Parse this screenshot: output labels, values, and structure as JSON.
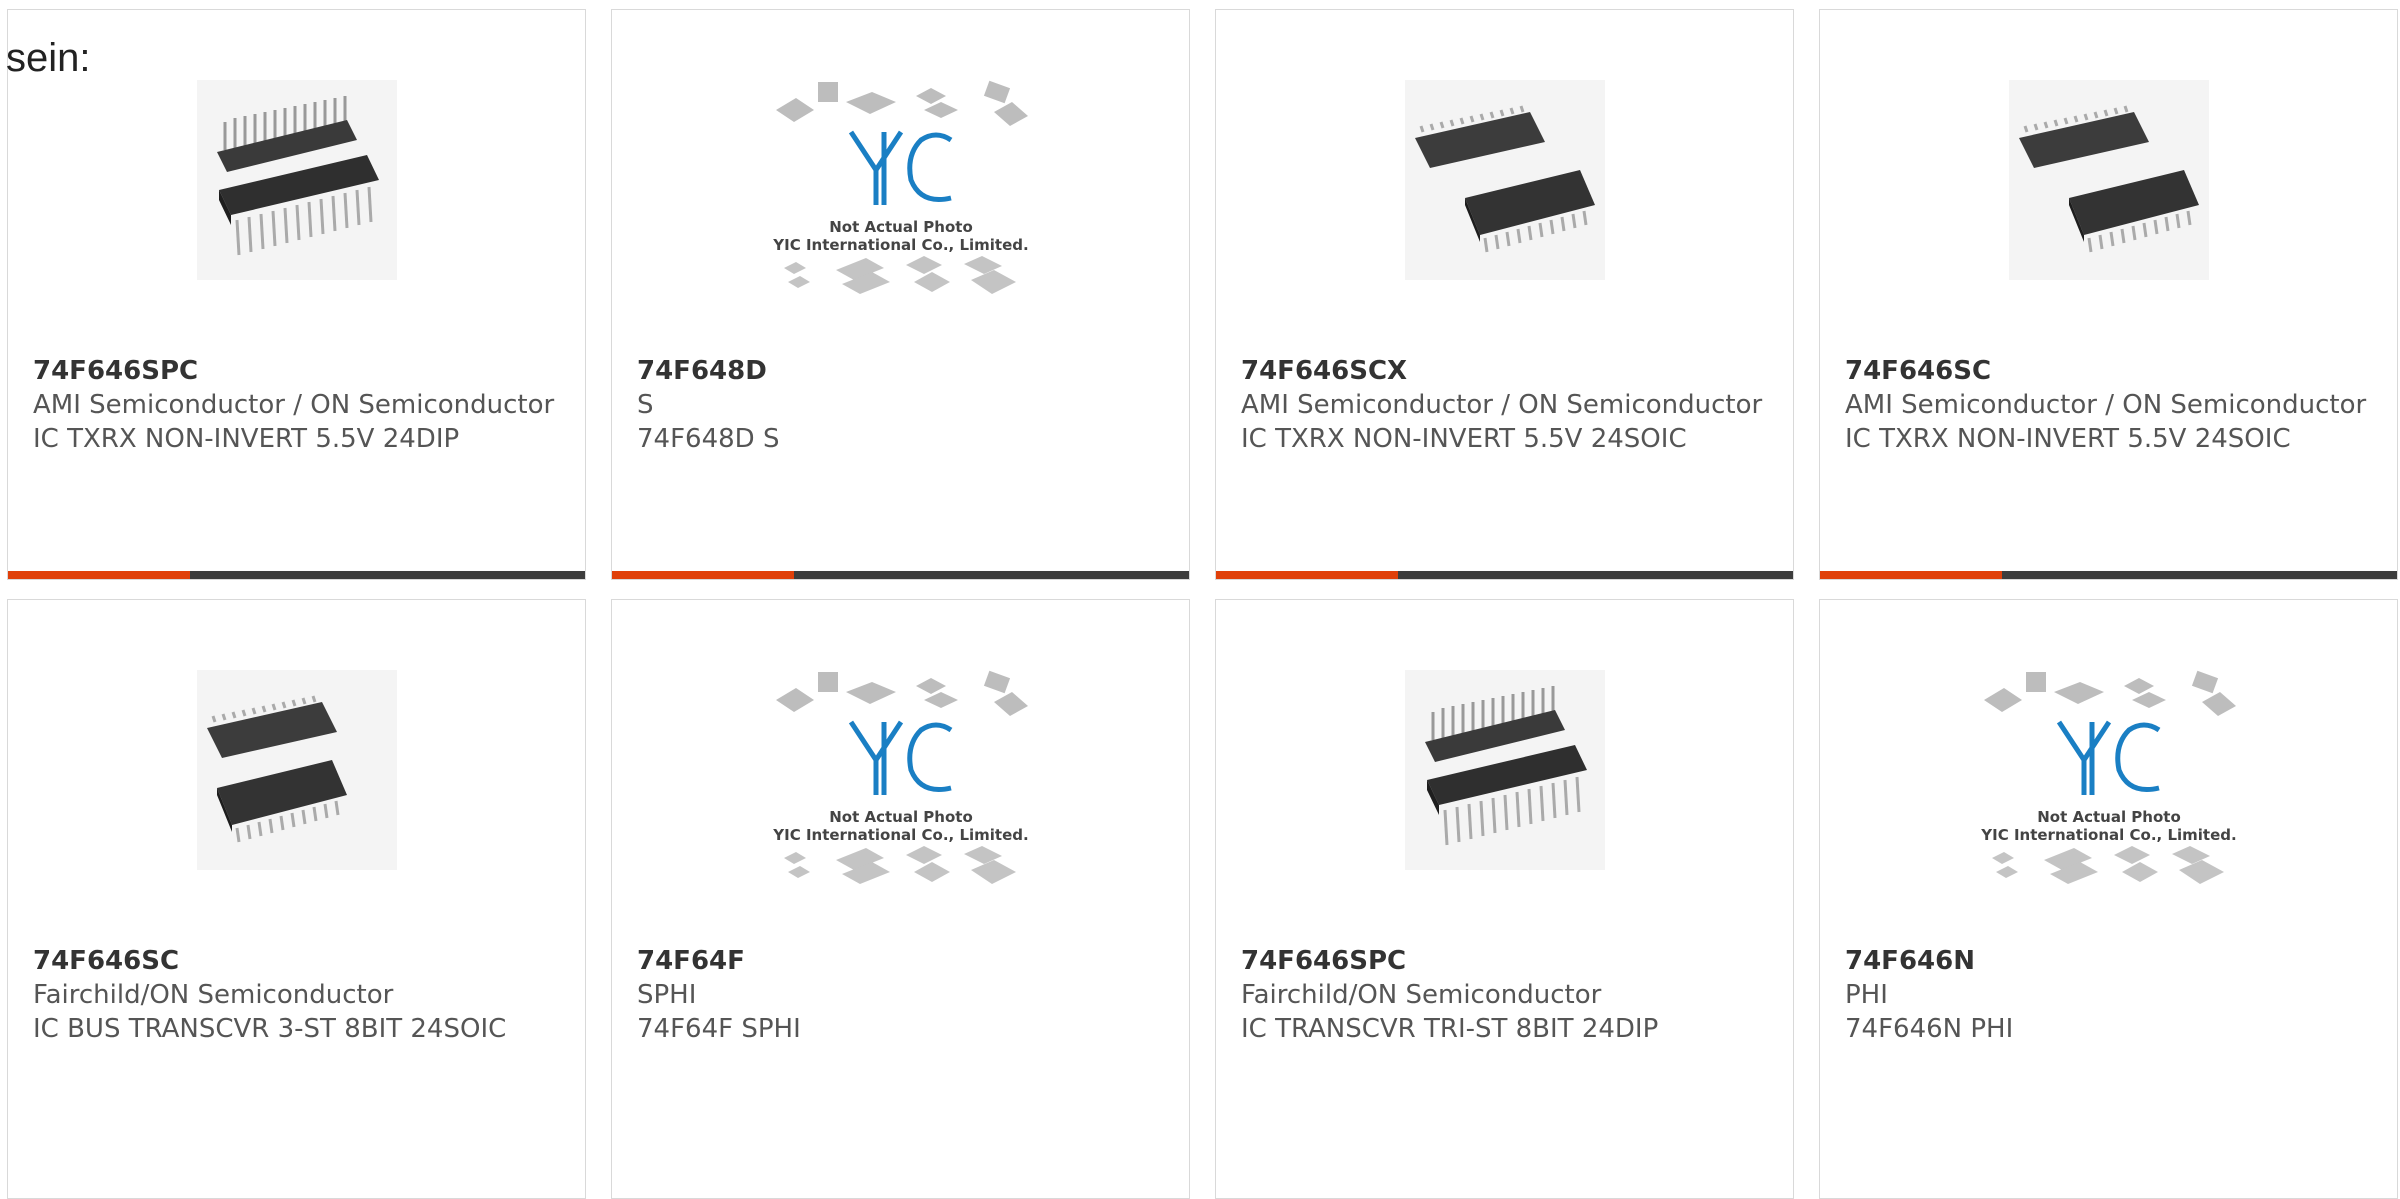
{
  "intro_text": "sein:",
  "colors": {
    "accent": "#e0400a",
    "bar": "#3d3d3d"
  },
  "products": [
    {
      "part_number": "74F646SPC",
      "manufacturer": "AMI Semiconductor / ON Semiconductor",
      "description": "IC TXRX NON-INVERT 5.5V 24DIP",
      "image": "dip-package-icon"
    },
    {
      "part_number": "74F648D",
      "manufacturer": "S",
      "description": "74F648D S",
      "image": "placeholder-logo-icon",
      "placeholder": {
        "line1": "Not Actual Photo",
        "line2": "YIC International Co., Limited."
      }
    },
    {
      "part_number": "74F646SCX",
      "manufacturer": "AMI Semiconductor / ON Semiconductor",
      "description": "IC TXRX NON-INVERT 5.5V 24SOIC",
      "image": "soic-package-icon"
    },
    {
      "part_number": "74F646SC",
      "manufacturer": "AMI Semiconductor / ON Semiconductor",
      "description": "IC TXRX NON-INVERT 5.5V 24SOIC",
      "image": "soic-package-icon"
    },
    {
      "part_number": "74F646SC",
      "manufacturer": "Fairchild/ON Semiconductor",
      "description": "IC BUS TRANSCVR 3-ST 8BIT 24SOIC",
      "image": "soic-package-icon"
    },
    {
      "part_number": "74F64F",
      "manufacturer": "SPHI",
      "description": "74F64F SPHI",
      "image": "placeholder-logo-icon",
      "placeholder": {
        "line1": "Not Actual Photo",
        "line2": "YIC International Co., Limited."
      }
    },
    {
      "part_number": "74F646SPC",
      "manufacturer": "Fairchild/ON Semiconductor",
      "description": "IC TRANSCVR TRI-ST 8BIT 24DIP",
      "image": "dip-package-icon"
    },
    {
      "part_number": "74F646N",
      "manufacturer": "PHI",
      "description": "74F646N PHI",
      "image": "placeholder-logo-icon",
      "placeholder": {
        "line1": "Not Actual Photo",
        "line2": "YIC International Co., Limited."
      }
    }
  ]
}
